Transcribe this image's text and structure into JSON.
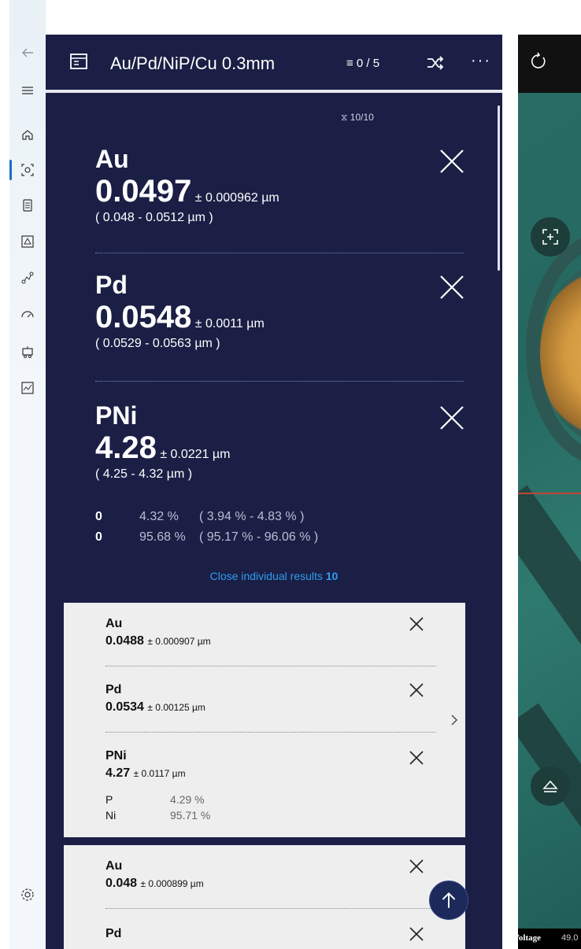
{
  "header": {
    "title": "Au/Pd/NiP/Cu 0.3mm",
    "counter": "≡ 0 / 5",
    "more": "···"
  },
  "filter_count": "10/10",
  "results": [
    {
      "element": "Au",
      "value": "0.0497",
      "uncertainty": "± 0.000962 µm",
      "range": "( 0.048 - 0.0512 µm )"
    },
    {
      "element": "Pd",
      "value": "0.0548",
      "uncertainty": "± 0.0011 µm",
      "range": "( 0.0529 - 0.0563 µm )"
    },
    {
      "element": "PNi",
      "value": "4.28",
      "uncertainty": "± 0.0221 µm",
      "range": "( 4.25 - 4.32 µm )"
    }
  ],
  "composition": [
    {
      "key": "0",
      "pct": "4.32 %",
      "range": "( 3.94 % - 4.83 % )"
    },
    {
      "key": "0",
      "pct": "95.68 %",
      "range": "( 95.17 % - 96.06 % )"
    }
  ],
  "close_individual": {
    "label": "Close individual results",
    "count": "10"
  },
  "cards": [
    {
      "items": [
        {
          "element": "Au",
          "value": "0.0488",
          "uncertainty": "± 0.000907 µm"
        },
        {
          "element": "Pd",
          "value": "0.0534",
          "uncertainty": "± 0.00125 µm"
        },
        {
          "element": "PNi",
          "value": "4.27",
          "uncertainty": "± 0.0117 µm"
        }
      ],
      "composition": [
        {
          "key": "P",
          "pct": "4.29 %"
        },
        {
          "key": "Ni",
          "pct": "95.71 %"
        }
      ]
    },
    {
      "items": [
        {
          "element": "Au",
          "value": "0.048",
          "uncertainty": "± 0.000899 µm"
        },
        {
          "element": "Pd"
        }
      ]
    }
  ],
  "status_bar": {
    "label": "Voltage",
    "value": "49.0"
  },
  "colors": {
    "panel": "#1b1f45",
    "accent": "#2f9df0",
    "card": "#eeeeee"
  },
  "icons": [
    "back-arrow-icon",
    "hamburger-icon",
    "home-icon",
    "measure-icon",
    "document-icon",
    "inspect-icon",
    "graph-icon",
    "gauge-icon",
    "robot-icon",
    "chart-icon",
    "settings-icon"
  ]
}
